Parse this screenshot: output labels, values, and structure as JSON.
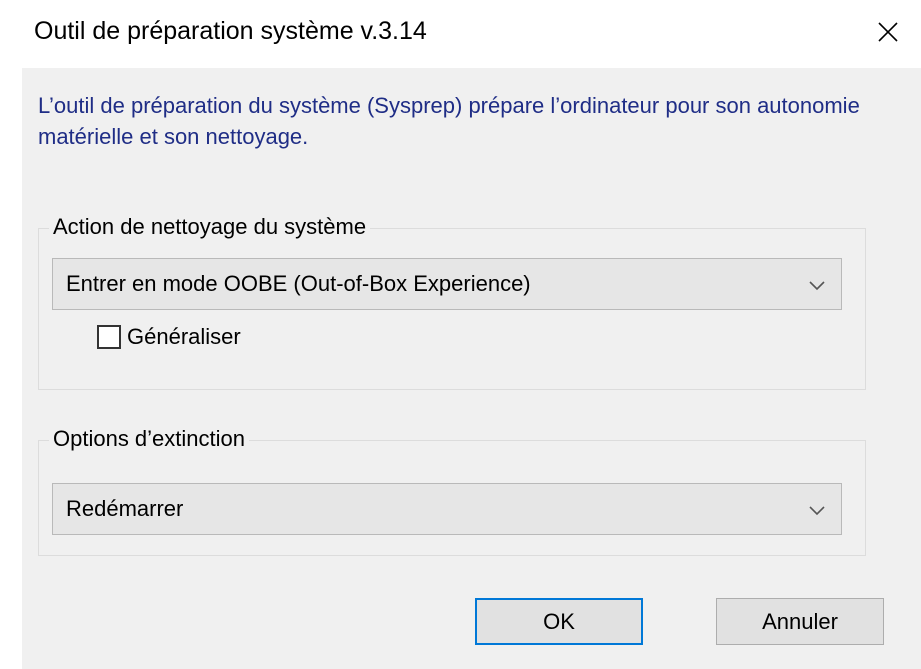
{
  "window": {
    "title": "Outil de préparation système v.3.14",
    "close_icon": "close-icon"
  },
  "intro": {
    "text": "L’outil de préparation du système (Sysprep) prépare l’ordinateur pour son autonomie matérielle et son nettoyage."
  },
  "cleanup": {
    "group_label": "Action de nettoyage du système",
    "selected": "Entrer en mode OOBE (Out-of-Box Experience)",
    "arrow_icon": "chevron-down-icon",
    "generalize_label": "Généraliser",
    "generalize_checked": false
  },
  "shutdown": {
    "group_label": "Options d’extinction",
    "selected": "Redémarrer",
    "arrow_icon": "chevron-down-icon"
  },
  "buttons": {
    "ok_label": "OK",
    "cancel_label": "Annuler"
  },
  "colors": {
    "intro_text": "#1f2d86",
    "dialog_background": "#f0f0f0",
    "default_button_border": "#0078d7"
  }
}
